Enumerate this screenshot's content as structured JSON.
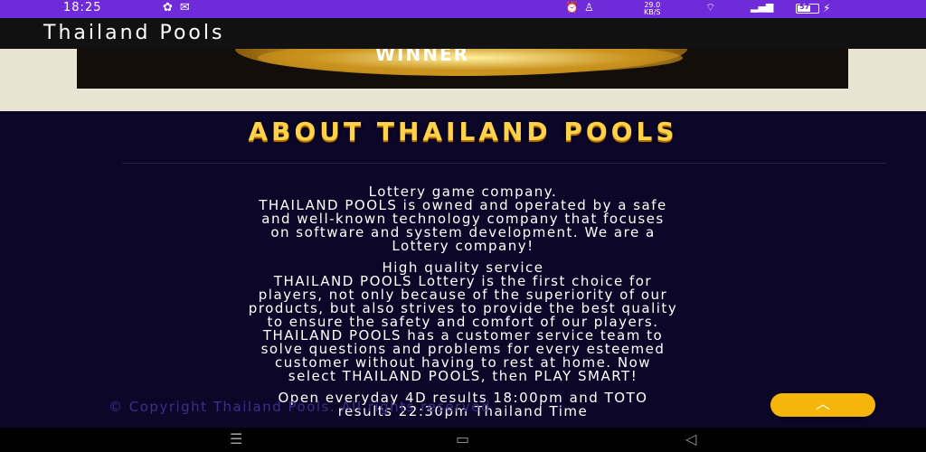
{
  "status_bar": {
    "time": "18:25",
    "network_speed_value": "29.0",
    "network_speed_unit": "KB/S",
    "battery_level": "57",
    "battery_fraction": 0.57
  },
  "app": {
    "title": "Thailand Pools"
  },
  "banner": {
    "text": "WINNER"
  },
  "about": {
    "heading": "ABOUT THAILAND POOLS",
    "lines": [
      "Lottery game company.",
      "THAILAND POOLS is owned and operated by a safe",
      "and well-known technology company that focuses",
      "on software and system development. We are a",
      "Lottery company!",
      "High quality service",
      "THAILAND POOLS Lottery is the first choice for",
      "players, not only because of the superiority of our",
      "products, but also strives to provide the best quality",
      "to ensure the safety and comfort of our players.",
      "THAILAND POOLS has a customer service team to",
      "solve questions and problems for every esteemed",
      "customer without having to rest at home. Now",
      "select THAILAND POOLS, then PLAY SMART!",
      "Open everyday 4D results 18:00pm and TOTO",
      "results 22:30pm Thailand Time"
    ],
    "copyright": "© Copyright Thailand Pools. All rights reserved"
  },
  "colors": {
    "status_bar": "#6f2bd9",
    "app_bar": "#111111",
    "page_background": "#0c0628",
    "heading": "#ffd24a",
    "scroll_button": "#f5b50b"
  },
  "icons": {
    "scroll_top": "chevron-up-icon",
    "nav_recents": "recents-icon",
    "nav_home": "home-icon",
    "nav_back": "back-icon"
  }
}
